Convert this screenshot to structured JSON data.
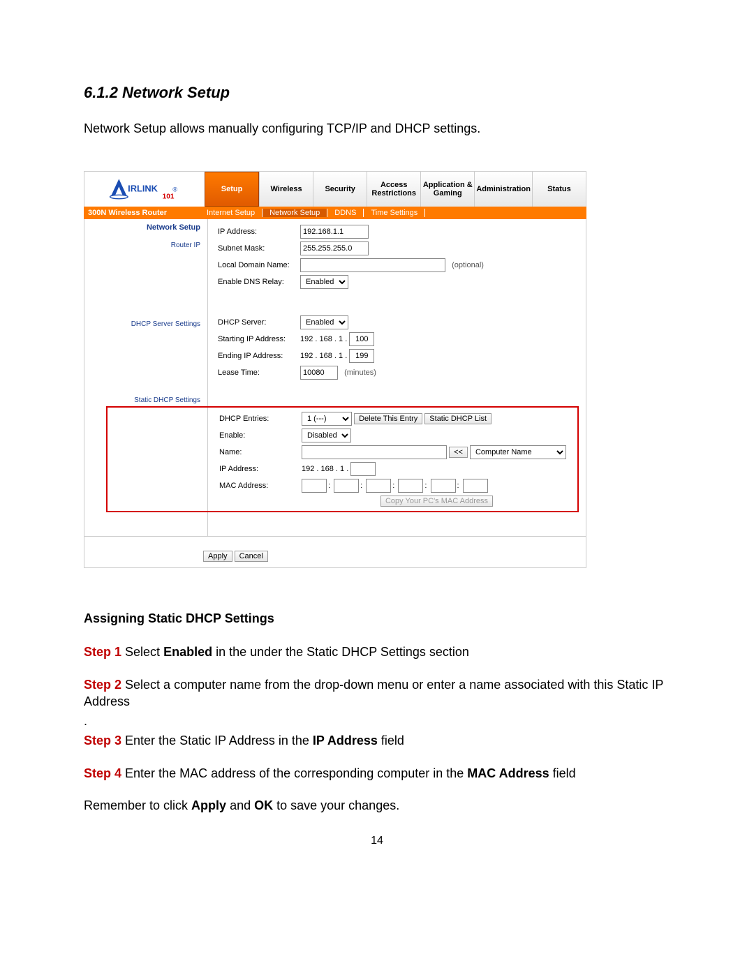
{
  "doc": {
    "section_title": "6.1.2 Network Setup",
    "intro": "Network Setup allows manually configuring TCP/IP and DHCP settings.",
    "subhead": "Assigning Static DHCP Settings",
    "step1_label": "Step 1",
    "step1_text_a": " Select ",
    "step1_bold": "Enabled",
    "step1_text_b": " in the under the Static DHCP Settings section",
    "step2_label": "Step 2",
    "step2_text": " Select a computer name from the drop-down menu or enter a name associated with this Static IP Address",
    "dot": ".",
    "step3_label": "Step 3",
    "step3_text_a": " Enter the Static IP Address in the ",
    "step3_bold": "IP Address",
    "step3_text_b": " field",
    "step4_label": "Step 4",
    "step4_text_a": " Enter the MAC address of the corresponding computer in the ",
    "step4_bold": "MAC Address",
    "step4_text_b": " field",
    "remember_a": "Remember to click ",
    "remember_b1": "Apply",
    "remember_mid": " and ",
    "remember_b2": "OK",
    "remember_c": " to save your changes.",
    "pagenum": "14"
  },
  "router": {
    "model": "300N Wireless Router",
    "nav": {
      "setup": "Setup",
      "wireless": "Wireless",
      "security": "Security",
      "access": "Access Restrictions",
      "app": "Application & Gaming",
      "admin": "Administration",
      "status": "Status"
    },
    "subtabs": {
      "internet": "Internet Setup",
      "network": "Network Setup",
      "ddns": "DDNS",
      "time": "Time Settings"
    },
    "left": {
      "title": "Network Setup",
      "router_ip": "Router IP",
      "dhcp_settings": "DHCP Server Settings",
      "static_dhcp": "Static DHCP Settings"
    },
    "routerip": {
      "ip_label": "IP Address:",
      "ip_value": "192.168.1.1",
      "subnet_label": "Subnet Mask:",
      "subnet_value": "255.255.255.0",
      "domain_label": "Local Domain Name:",
      "domain_value": "",
      "domain_note": "(optional)",
      "dns_label": "Enable DNS Relay:",
      "dns_value": "Enabled"
    },
    "dhcp": {
      "server_label": "DHCP Server:",
      "server_value": "Enabled",
      "start_label": "Starting IP Address:",
      "prefix": "192 . 168 . 1 .",
      "start_value": "100",
      "end_label": "Ending IP Address:",
      "end_value": "199",
      "lease_label": "Lease Time:",
      "lease_value": "10080",
      "lease_unit": "(minutes)"
    },
    "static": {
      "entries_label": "DHCP Entries:",
      "entries_value": "1 (---)",
      "delete_btn": "Delete This Entry",
      "list_btn": "Static DHCP List",
      "enable_label": "Enable:",
      "enable_value": "Disabled",
      "name_label": "Name:",
      "name_value": "",
      "arrow_btn": "<<",
      "computer_name": "Computer Name",
      "ip_label": "IP Address:",
      "ip_prefix": "192 . 168 . 1 .",
      "ip_value": "",
      "mac_label": "MAC Address:",
      "mac_sep": ":",
      "copy_btn": "Copy Your PC's MAC Address"
    },
    "actions": {
      "apply": "Apply",
      "cancel": "Cancel"
    }
  }
}
